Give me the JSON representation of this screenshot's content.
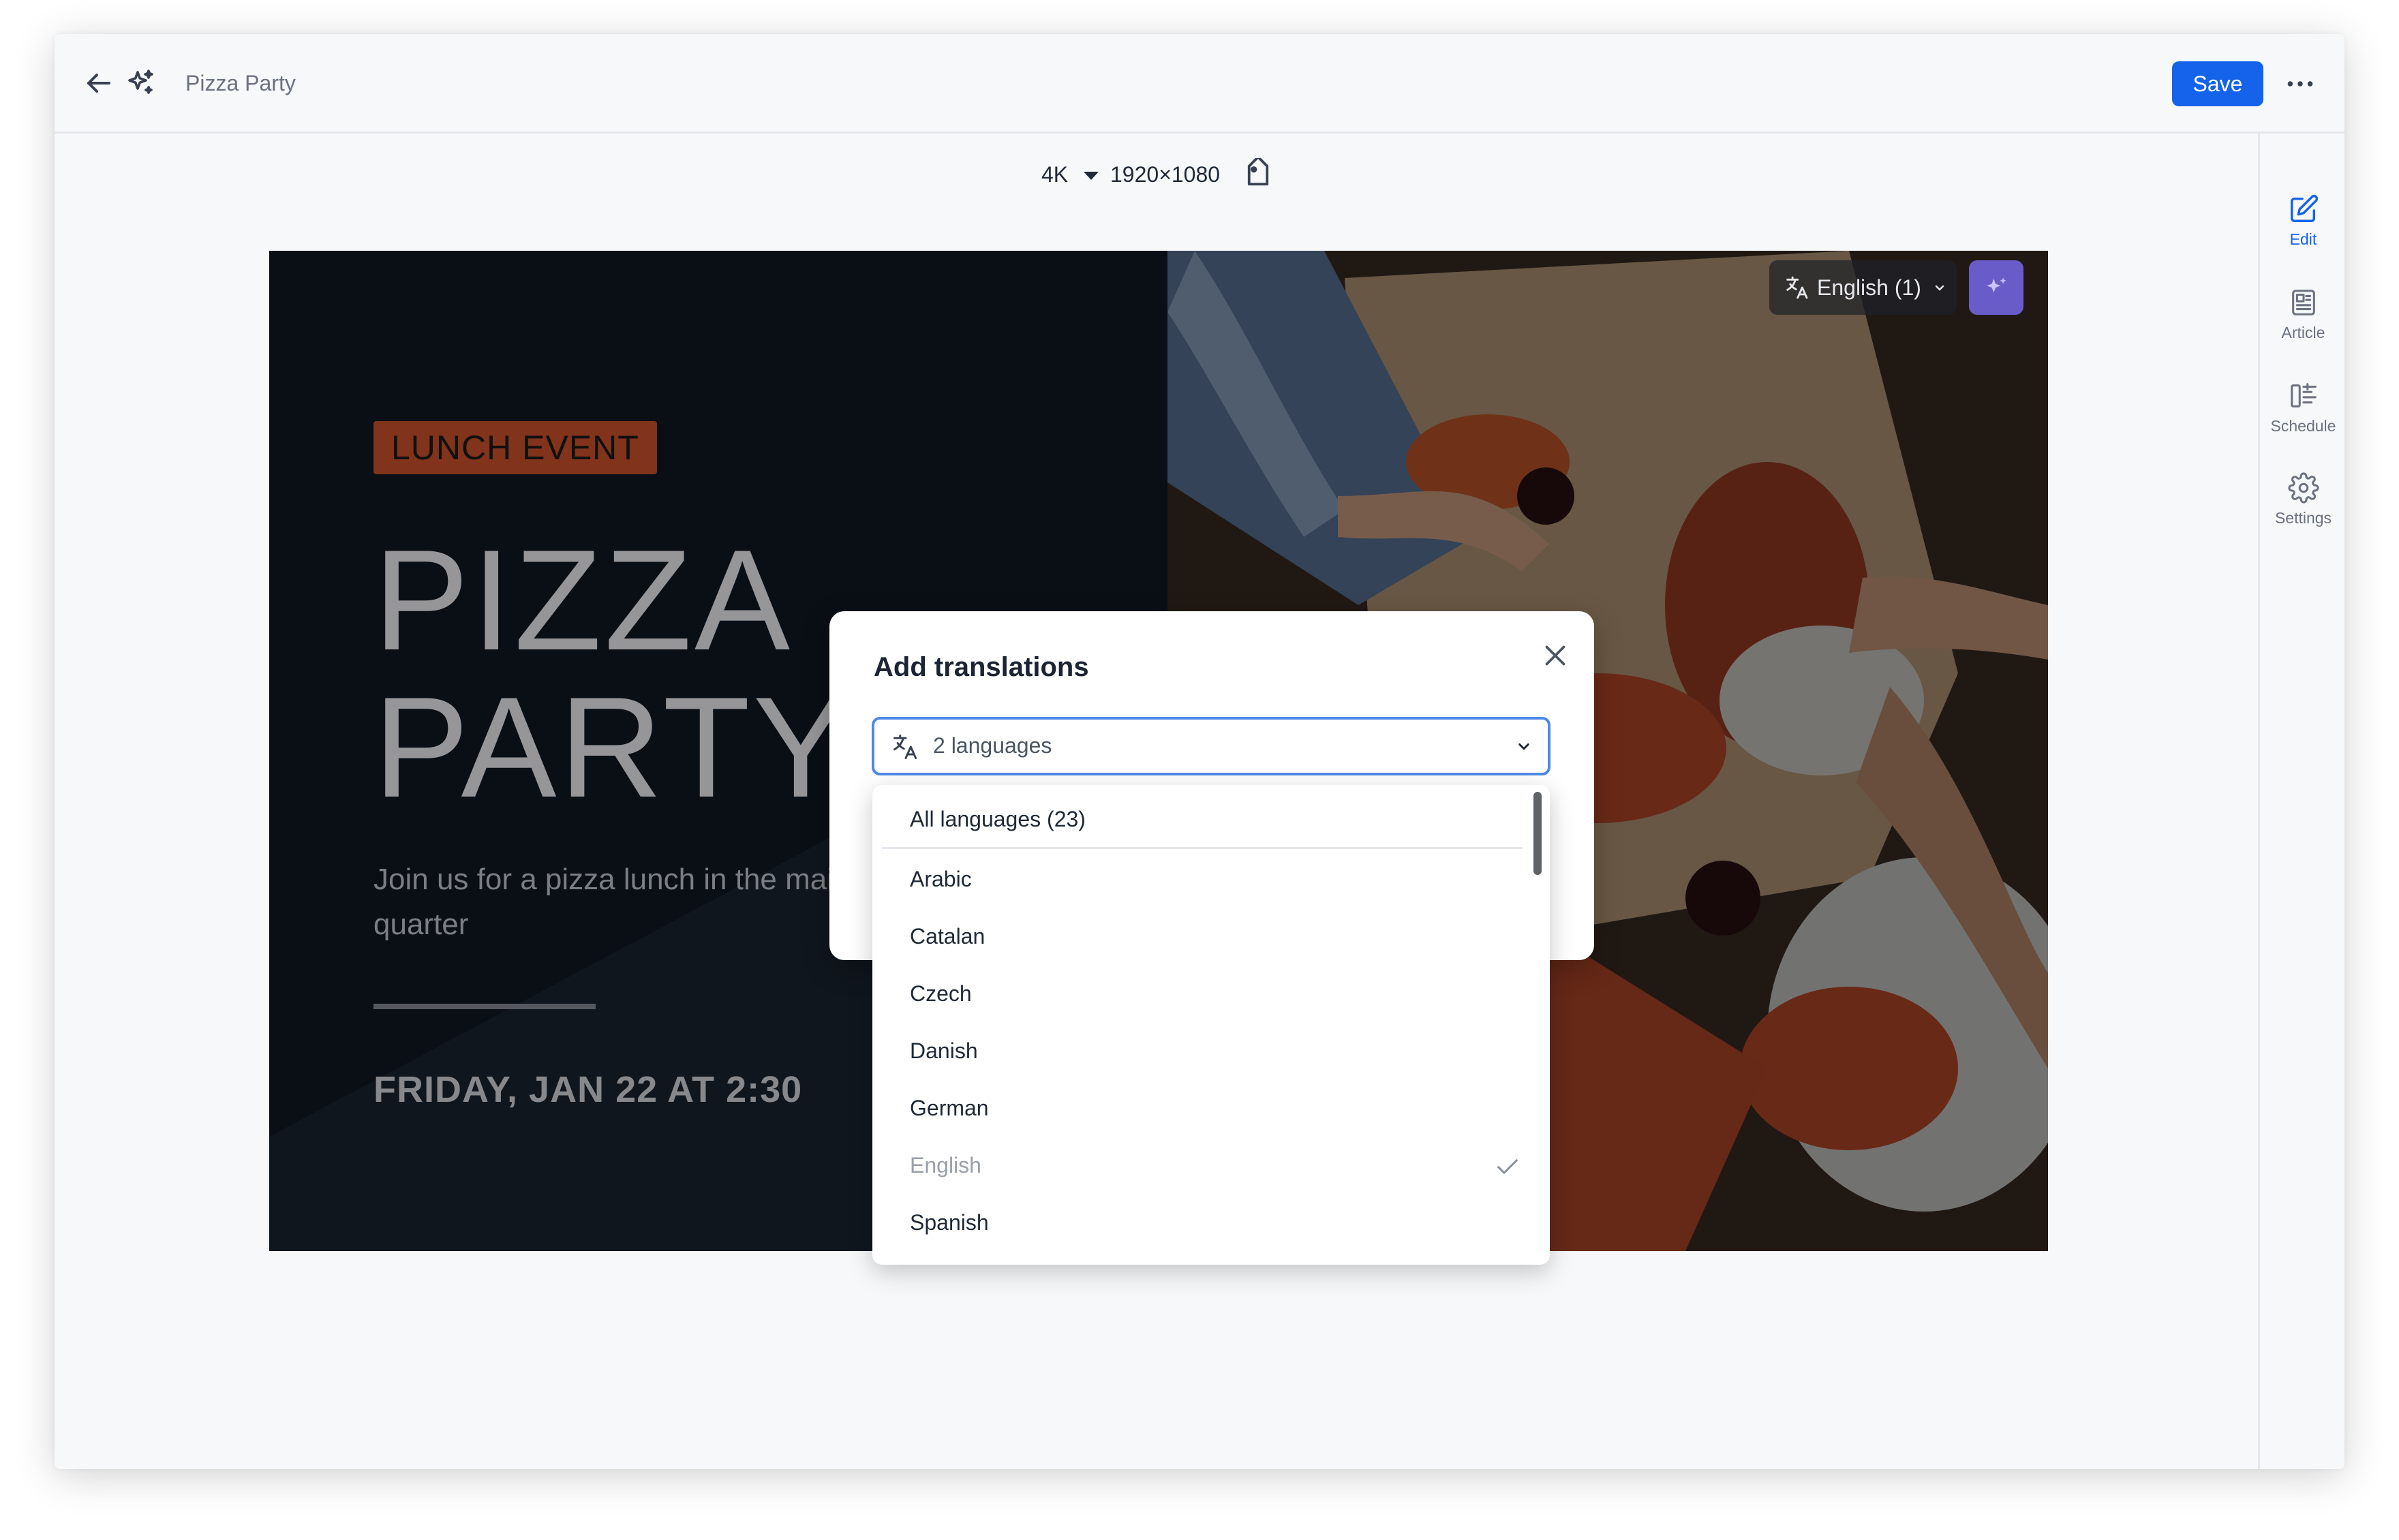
{
  "app": {
    "title": "Pizza Party",
    "save_label": "Save"
  },
  "rail": {
    "items": [
      {
        "label": "Edit",
        "icon": "edit-icon",
        "active": true
      },
      {
        "label": "Article",
        "icon": "article-icon",
        "active": false
      },
      {
        "label": "Schedule",
        "icon": "schedule-icon",
        "active": false
      },
      {
        "label": "Settings",
        "icon": "gear-icon",
        "active": false
      }
    ]
  },
  "canvas": {
    "resolution_label": "4K",
    "size_label": "1920×1080"
  },
  "slide": {
    "badge": "LUNCH EVENT",
    "headline_line1": "PIZZA",
    "headline_line2": "PARTY",
    "subtext": "Join us for a pizza lunch in the main campus to celebrate quarter",
    "date": "FRIDAY, JAN 22 AT 2:30",
    "language_pill": "English (1)",
    "colors": {
      "badge": "#d0532c",
      "background": "#111823"
    }
  },
  "modal": {
    "title": "Add translations",
    "select_value": "2 languages",
    "options": [
      {
        "label": "All languages (23)",
        "selected": false
      },
      {
        "label": "Arabic",
        "selected": false
      },
      {
        "label": "Catalan",
        "selected": false
      },
      {
        "label": "Czech",
        "selected": false
      },
      {
        "label": "Danish",
        "selected": false
      },
      {
        "label": "German",
        "selected": false
      },
      {
        "label": "English",
        "selected": true
      },
      {
        "label": "Spanish",
        "selected": false
      }
    ]
  },
  "colors": {
    "accent": "#1463ea"
  }
}
